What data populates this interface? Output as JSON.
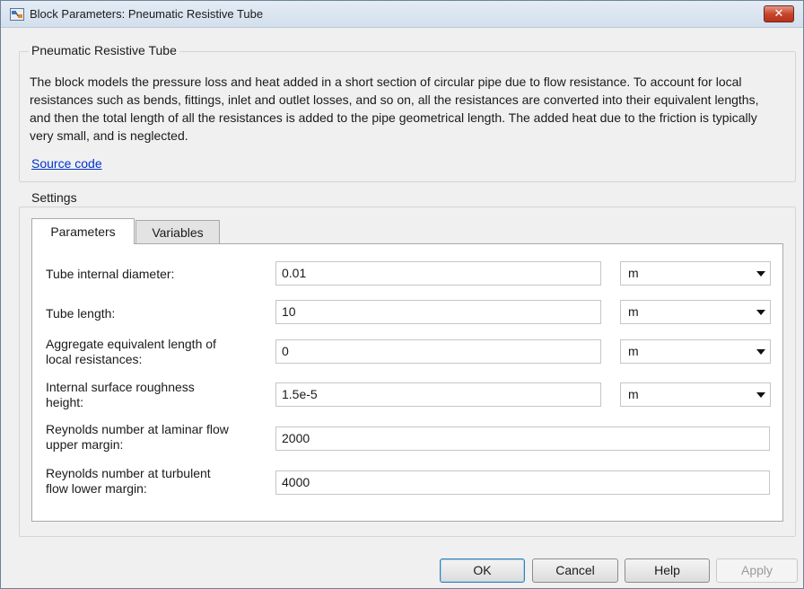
{
  "window": {
    "title": "Block Parameters: Pneumatic Resistive Tube",
    "close_glyph": "✕"
  },
  "block": {
    "name": "Pneumatic Resistive Tube",
    "description": "The block models the pressure loss and heat added in a short section of circular pipe due to flow resistance. To account for local resistances such as bends, fittings, inlet and outlet losses, and so on, all the resistances are converted into their equivalent lengths, and then the total length of all the resistances is added to the pipe geometrical length. The added heat due to the friction is typically very small, and is neglected.",
    "source_link": "Source code"
  },
  "settings": {
    "title": "Settings",
    "tabs": [
      {
        "label": "Parameters",
        "active": true
      },
      {
        "label": "Variables",
        "active": false
      }
    ],
    "params": [
      {
        "label_line1": "Tube internal diameter:",
        "label_line2": "",
        "value": "0.01",
        "unit": "m"
      },
      {
        "label_line1": "Tube length:",
        "label_line2": "",
        "value": "10",
        "unit": "m"
      },
      {
        "label_line1": "Aggregate equivalent length of",
        "label_line2": "local resistances:",
        "value": "0",
        "unit": "m"
      },
      {
        "label_line1": "Internal surface roughness",
        "label_line2": "height:",
        "value": "1.5e-5",
        "unit": "m"
      },
      {
        "label_line1": "Reynolds number at laminar flow",
        "label_line2": "upper margin:",
        "value": "2000",
        "unit": ""
      },
      {
        "label_line1": "Reynolds number at turbulent",
        "label_line2": "flow lower margin:",
        "value": "4000",
        "unit": ""
      }
    ]
  },
  "buttons": {
    "ok": "OK",
    "cancel": "Cancel",
    "help": "Help",
    "apply": "Apply"
  },
  "colors": {
    "link": "#0033cc",
    "close_button": "#c8452c",
    "default_button_border": "#3c7fb1"
  }
}
